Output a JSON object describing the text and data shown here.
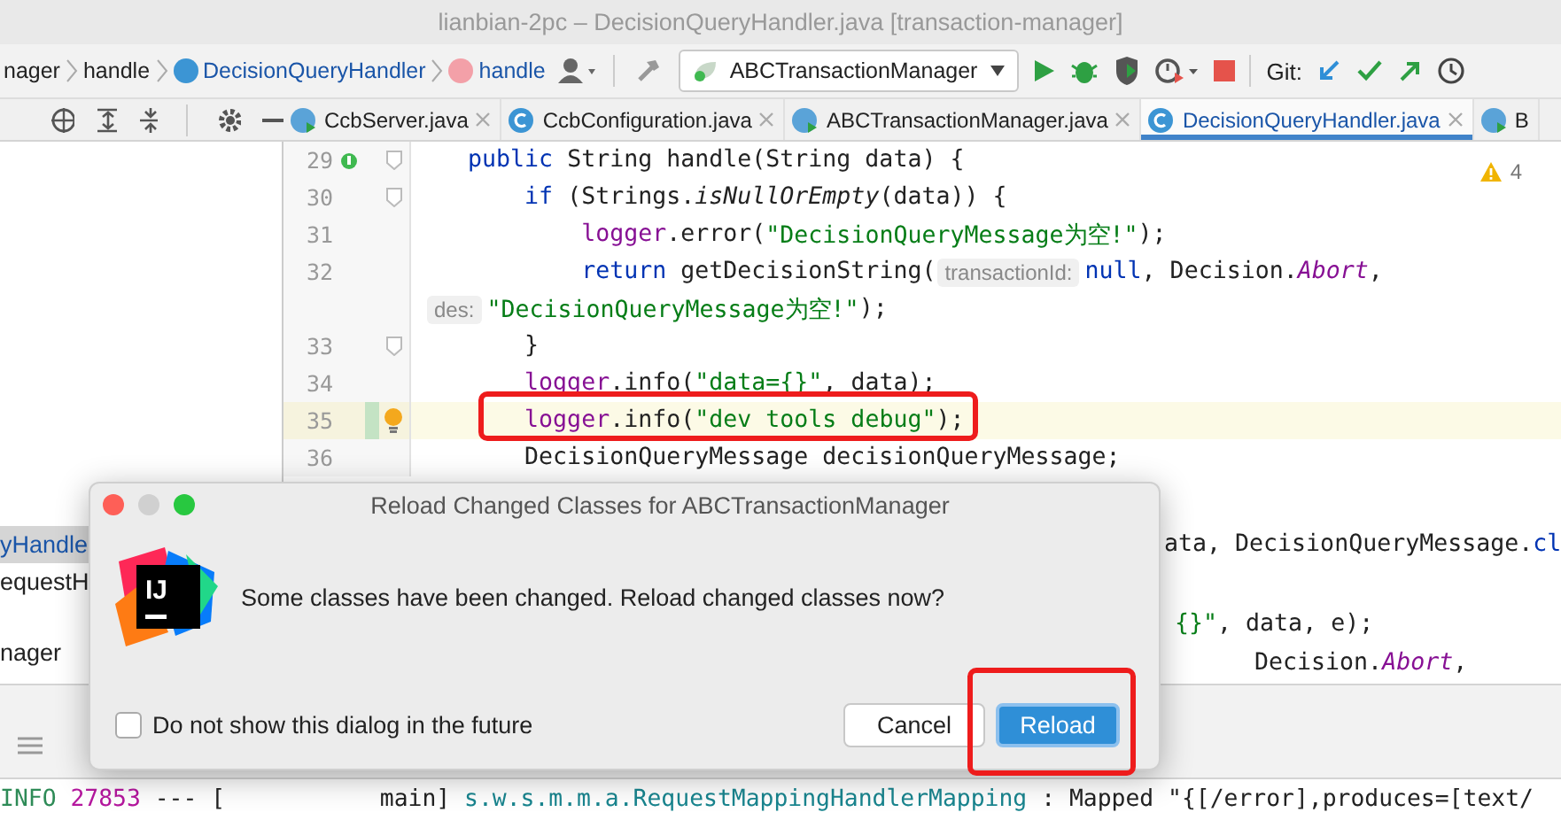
{
  "window": {
    "title": "lianbian-2pc – DecisionQueryHandler.java [transaction-manager]"
  },
  "breadcrumbs": [
    {
      "label": "nager",
      "kind": "plain"
    },
    {
      "label": "handle",
      "kind": "plain"
    },
    {
      "label": "DecisionQueryHandler",
      "kind": "class"
    },
    {
      "label": "handle",
      "kind": "method"
    }
  ],
  "run_config": {
    "label": "ABCTransactionManager"
  },
  "vcs": {
    "label": "Git:"
  },
  "tabs": [
    {
      "label": "CcbServer.java",
      "selected": false,
      "kind": "runnable"
    },
    {
      "label": "CcbConfiguration.java",
      "selected": false,
      "kind": "class"
    },
    {
      "label": "ABCTransactionManager.java",
      "selected": false,
      "kind": "runnable"
    },
    {
      "label": "DecisionQueryHandler.java",
      "selected": true,
      "kind": "class"
    },
    {
      "label": "B",
      "selected": false,
      "kind": "runnable"
    }
  ],
  "project_tree": [
    {
      "label": "yHandle",
      "selected": true
    },
    {
      "label": "equestH",
      "selected": false
    },
    {
      "label": "nager",
      "selected": false
    }
  ],
  "editor": {
    "warnings": "4",
    "lines": [
      {
        "number": "29",
        "implements": true,
        "bulb": false,
        "fold": true,
        "current": false,
        "changed": false,
        "segments": [
          {
            "text": "    public",
            "kind": "kw"
          },
          {
            "text": " String handle(String data) {",
            "kind": "plain"
          }
        ]
      },
      {
        "number": "30",
        "fold": true,
        "current": false,
        "changed": false,
        "segments": [
          {
            "text": "        if",
            "kind": "kw"
          },
          {
            "text": " (Strings.",
            "kind": "plain"
          },
          {
            "text": "isNullOrEmpty",
            "kind": "italic"
          },
          {
            "text": "(data)) {",
            "kind": "plain"
          }
        ]
      },
      {
        "number": "31",
        "fold": false,
        "current": false,
        "changed": false,
        "segments": [
          {
            "text": "            logger",
            "kind": "field"
          },
          {
            "text": ".error(",
            "kind": "plain"
          },
          {
            "text": "\"DecisionQueryMessage为空!\"",
            "kind": "str"
          },
          {
            "text": ");",
            "kind": "plain"
          }
        ]
      },
      {
        "number": "32",
        "fold": false,
        "current": false,
        "changed": false,
        "segments": [
          {
            "text": "            return",
            "kind": "kw"
          },
          {
            "text": " getDecisionString(",
            "kind": "plain"
          },
          {
            "text": "transactionId:",
            "kind": "hint"
          },
          {
            "text": "null",
            "kind": "kw"
          },
          {
            "text": ", Decision.",
            "kind": "plain"
          },
          {
            "text": "Abort",
            "kind": "static"
          },
          {
            "text": ",",
            "kind": "plain"
          }
        ]
      },
      {
        "wrap": true,
        "fold": false,
        "current": false,
        "changed": false,
        "segments": [
          {
            "text": "des:",
            "kind": "hint"
          },
          {
            "text": "\"DecisionQueryMessage为空!\"",
            "kind": "str"
          },
          {
            "text": ");",
            "kind": "plain"
          }
        ]
      },
      {
        "number": "33",
        "fold": true,
        "current": false,
        "changed": false,
        "segments": [
          {
            "text": "        }",
            "kind": "plain"
          }
        ]
      },
      {
        "number": "34",
        "fold": false,
        "current": false,
        "changed": false,
        "segments": [
          {
            "text": "        logger",
            "kind": "field"
          },
          {
            "text": ".info(",
            "kind": "plain"
          },
          {
            "text": "\"data={}\"",
            "kind": "str"
          },
          {
            "text": ", data);",
            "kind": "plain"
          }
        ]
      },
      {
        "number": "35",
        "implements": false,
        "bulb": true,
        "fold": false,
        "current": true,
        "changed": true,
        "segments": [
          {
            "text": "        logger",
            "kind": "field"
          },
          {
            "text": ".info(",
            "kind": "plain"
          },
          {
            "text": "\"dev tools debug\"",
            "kind": "str"
          },
          {
            "text": ");",
            "kind": "plain"
          }
        ]
      },
      {
        "number": "36",
        "fold": false,
        "current": false,
        "changed": false,
        "segments": [
          {
            "text": "        DecisionQueryMessage decisionQueryMessage;",
            "kind": "plain"
          }
        ]
      }
    ],
    "clipped_lines": [
      {
        "segments": [
          {
            "text": "ata, DecisionQueryMessage.",
            "kind": "plain"
          },
          {
            "text": "cl",
            "kind": "kw"
          }
        ]
      },
      {
        "segments": [
          {
            "text": "{}\"",
            "kind": "str"
          },
          {
            "text": ", data, e);",
            "kind": "plain"
          }
        ]
      },
      {
        "segments": [
          {
            "text": "Decision.",
            "kind": "plain"
          },
          {
            "text": "Abort",
            "kind": "static"
          },
          {
            "text": ",",
            "kind": "plain"
          }
        ]
      }
    ]
  },
  "console": {
    "segments": [
      {
        "text": "INFO",
        "kind": "level"
      },
      {
        "text": " 27853",
        "kind": "pid"
      },
      {
        "text": " --- [           main] ",
        "kind": "plain"
      },
      {
        "text": "s.w.s.m.m.a.RequestMappingHandlerMapping",
        "kind": "logger"
      },
      {
        "text": " : Mapped \"{[/error],produces=[text/",
        "kind": "plain"
      }
    ]
  },
  "dialog": {
    "logo_text": "IJ",
    "title": "Reload Changed Classes for ABCTransactionManager",
    "message": "Some classes have been changed. Reload changed classes now?",
    "checkbox": {
      "label": "Do not show this dialog in the future",
      "checked": false
    },
    "buttons": [
      {
        "label": "Cancel",
        "default": false
      },
      {
        "label": "Reload",
        "default": true
      }
    ]
  }
}
